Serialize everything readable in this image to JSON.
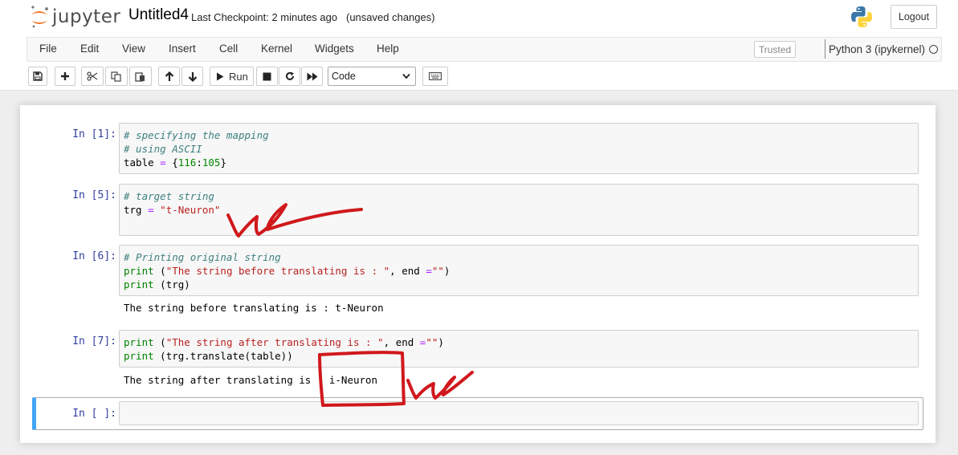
{
  "app": {
    "logo_text": "jupyter",
    "notebook_name": "Untitled4",
    "checkpoint": "Last Checkpoint: 2 minutes ago",
    "autosave": "(unsaved changes)",
    "logout_label": "Logout"
  },
  "menu": {
    "items": [
      "File",
      "Edit",
      "View",
      "Insert",
      "Cell",
      "Kernel",
      "Widgets",
      "Help"
    ],
    "trusted_label": "Trusted",
    "kernel_name": "Python 3 (ipykernel)"
  },
  "toolbar": {
    "run_label": "Run",
    "cell_type": "Code",
    "icons": [
      "save-icon",
      "plus-icon",
      "scissors-icon",
      "copy-icon",
      "paste-icon",
      "arrow-up-icon",
      "arrow-down-icon",
      "play-icon",
      "stop-icon",
      "restart-icon",
      "fast-forward-icon",
      "keyboard-icon"
    ]
  },
  "cells": [
    {
      "prompt": "In [1]:",
      "lines": [
        [
          {
            "t": "# specifying the mapping",
            "c": "cm"
          }
        ],
        [
          {
            "t": "# using ASCII",
            "c": "cm"
          }
        ],
        [
          {
            "t": "table ",
            "c": ""
          },
          {
            "t": "=",
            "c": "op"
          },
          {
            "t": " {",
            "c": ""
          },
          {
            "t": "116",
            "c": "num"
          },
          {
            "t": ":",
            "c": ""
          },
          {
            "t": "105",
            "c": "num"
          },
          {
            "t": "}",
            "c": ""
          }
        ]
      ],
      "output": ""
    },
    {
      "prompt": "In [5]:",
      "lines": [
        [
          {
            "t": "# target string",
            "c": "cm"
          }
        ],
        [
          {
            "t": "trg ",
            "c": ""
          },
          {
            "t": "=",
            "c": "op"
          },
          {
            "t": " ",
            "c": ""
          },
          {
            "t": "\"t-Neuron\"",
            "c": "str"
          }
        ]
      ],
      "output": ""
    },
    {
      "prompt": "In [6]:",
      "lines": [
        [
          {
            "t": "# Printing original string",
            "c": "cm"
          }
        ],
        [
          {
            "t": "print",
            "c": "bi"
          },
          {
            "t": " (",
            "c": ""
          },
          {
            "t": "\"The string before translating is : \"",
            "c": "str"
          },
          {
            "t": ", end ",
            "c": ""
          },
          {
            "t": "=",
            "c": "op"
          },
          {
            "t": "\"\"",
            "c": "str"
          },
          {
            "t": ")",
            "c": ""
          }
        ],
        [
          {
            "t": "print",
            "c": "bi"
          },
          {
            "t": " (trg)",
            "c": ""
          }
        ]
      ],
      "output": "The string before translating is : t-Neuron"
    },
    {
      "prompt": "In [7]:",
      "lines": [
        [
          {
            "t": "print",
            "c": "bi"
          },
          {
            "t": " (",
            "c": ""
          },
          {
            "t": "\"The string after translating is : \"",
            "c": "str"
          },
          {
            "t": ", end ",
            "c": ""
          },
          {
            "t": "=",
            "c": "op"
          },
          {
            "t": "\"\"",
            "c": "str"
          },
          {
            "t": ")",
            "c": ""
          }
        ],
        [
          {
            "t": "print",
            "c": "bi"
          },
          {
            "t": " (trg.translate(table))",
            "c": ""
          }
        ]
      ],
      "output": "The string after translating is : i-Neuron"
    },
    {
      "prompt": "In [ ]:",
      "lines": [],
      "output": ""
    }
  ],
  "colors": {
    "accent": "#42a5f5",
    "prompt": "#303f9f",
    "annotation": "#d0181c",
    "jupyter_orange": "#f37726"
  }
}
